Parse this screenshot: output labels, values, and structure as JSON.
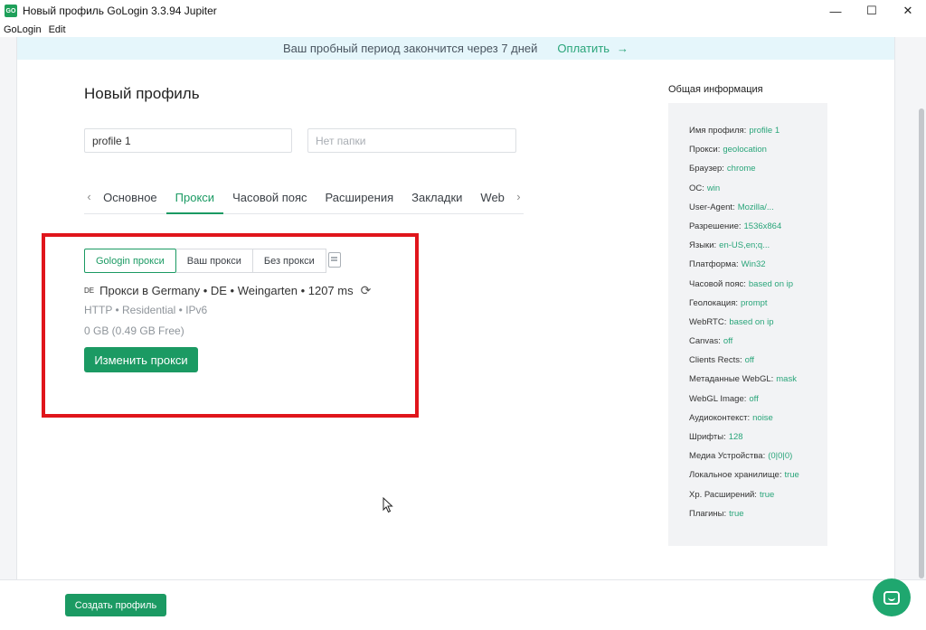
{
  "window": {
    "title": "Новый профиль GoLogin 3.3.94 Jupiter",
    "app_icon_text": "GO",
    "controls": {
      "minimize": "—",
      "maximize": "☐",
      "close": "✕"
    }
  },
  "menu": {
    "items": [
      "GoLogin",
      "Edit"
    ]
  },
  "banner": {
    "text": "Ваш пробный период закончится через 7 дней",
    "pay_label": "Оплатить",
    "pay_arrow": "→"
  },
  "form": {
    "title": "Новый профиль",
    "profile_name": "profile 1",
    "folder_placeholder": "Нет папки"
  },
  "tabs": {
    "prev_arrow": "‹",
    "next_arrow": "›",
    "items": [
      "Основное",
      "Прокси",
      "Часовой пояс",
      "Расширения",
      "Закладки",
      "Web"
    ],
    "active": "Прокси"
  },
  "proxy": {
    "options": [
      "Gologin прокси",
      "Ваш прокси",
      "Без прокси"
    ],
    "active_option": "Gologin прокси",
    "flag_code": "DE",
    "location": "Прокси в Germany • DE • Weingarten • 1207 ms",
    "meta": "HTTP • Residential • IPv6",
    "traffic": "0 GB (0.49 GB Free)",
    "change_label": "Изменить прокси"
  },
  "info": {
    "heading": "Общая информация",
    "rows": [
      {
        "label": "Имя профиля:",
        "value": "profile 1"
      },
      {
        "label": "Прокси:",
        "value": "geolocation"
      },
      {
        "label": "Браузер:",
        "value": "chrome"
      },
      {
        "label": "ОС:",
        "value": "win"
      },
      {
        "label": "User-Agent:",
        "value": "Mozilla/..."
      },
      {
        "label": "Разрешение:",
        "value": "1536x864"
      },
      {
        "label": "Языки:",
        "value": "en-US,en;q..."
      },
      {
        "label": "Платформа:",
        "value": "Win32"
      },
      {
        "label": "Часовой пояс:",
        "value": "based on ip"
      },
      {
        "label": "Геолокация:",
        "value": "prompt"
      },
      {
        "label": "WebRTC:",
        "value": "based on ip"
      },
      {
        "label": "Canvas:",
        "value": "off"
      },
      {
        "label": "Clients Rects:",
        "value": "off"
      },
      {
        "label": "Метаданные WebGL:",
        "value": "mask"
      },
      {
        "label": "WebGL Image:",
        "value": "off"
      },
      {
        "label": "Аудиоконтекст:",
        "value": "noise"
      },
      {
        "label": "Шрифты:",
        "value": "128"
      },
      {
        "label": "Медиа Устройства:",
        "value": "(0|0|0)"
      },
      {
        "label": "Локальное хранилище:",
        "value": "true"
      },
      {
        "label": "Хр. Расширений:",
        "value": "true"
      },
      {
        "label": "Плагины:",
        "value": "true"
      }
    ]
  },
  "footer": {
    "create_label": "Создать профиль"
  },
  "colors": {
    "accent": "#1b9a63",
    "highlight": "#e0151b",
    "banner_bg": "#e5f6fb"
  }
}
